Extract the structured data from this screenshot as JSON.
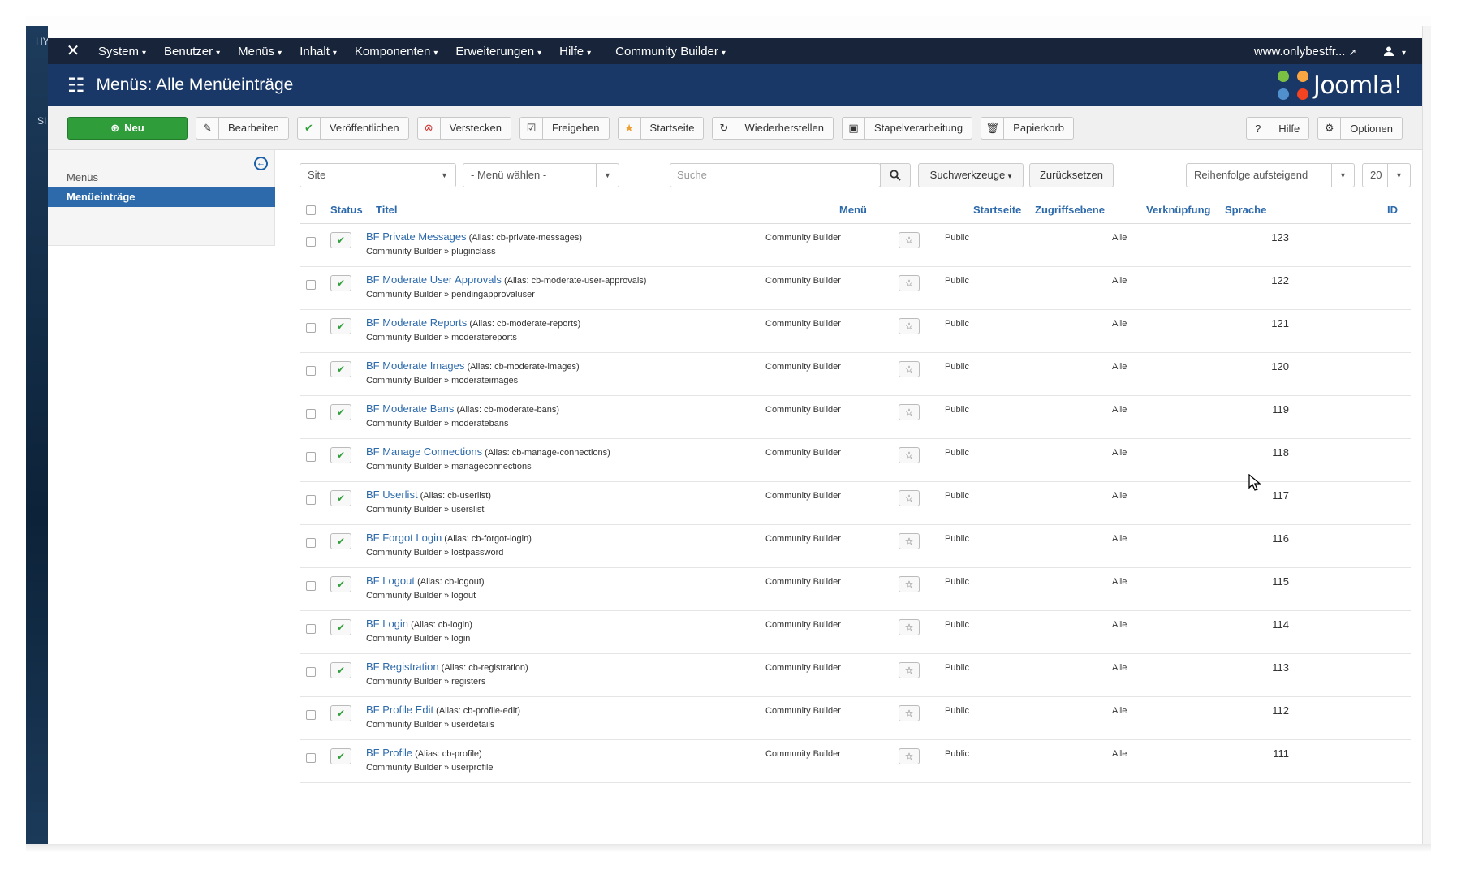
{
  "desktop": {
    "side_letters": [
      "HY",
      "SI"
    ]
  },
  "topnav": {
    "items": [
      {
        "label": "System"
      },
      {
        "label": "Benutzer"
      },
      {
        "label": "Menüs"
      },
      {
        "label": "Inhalt"
      },
      {
        "label": "Komponenten"
      },
      {
        "label": "Erweiterungen"
      },
      {
        "label": "Hilfe"
      },
      {
        "label": "Community Builder"
      }
    ],
    "site_link": "www.onlybestfr...",
    "caret": "▾",
    "user_icon": "user-icon",
    "external_icon": "↗"
  },
  "header": {
    "title": "Menüs: Alle Menüeinträge",
    "logo_text": "Joomla!",
    "logo_mark": "®"
  },
  "toolbar": {
    "new": "Neu",
    "edit": "Bearbeiten",
    "publish": "Veröffentlichen",
    "unpublish": "Verstecken",
    "checkin": "Freigeben",
    "home": "Startseite",
    "rebuild": "Wiederherstellen",
    "batch": "Stapelverarbeitung",
    "trash": "Papierkorb",
    "help": "Hilfe",
    "options": "Optionen"
  },
  "sidebar": {
    "items": [
      {
        "label": "Menüs"
      },
      {
        "label": "Menüeinträge"
      }
    ]
  },
  "filters": {
    "site": "Site",
    "menu": "- Menü wählen -",
    "search_placeholder": "Suche",
    "search_tools": "Suchwerkzeuge",
    "reset": "Zurücksetzen",
    "ordering": "Reihenfolge aufsteigend",
    "limit": "20"
  },
  "columns": {
    "status": "Status",
    "title": "Titel",
    "menu": "Menü",
    "home": "Startseite",
    "access": "Zugriffsebene",
    "association": "Verknüpfung",
    "language": "Sprache",
    "id": "ID"
  },
  "rows": [
    {
      "title": "BF Private Messages",
      "alias": "(Alias: cb-private-messages)",
      "path": "Community Builder » pluginclass",
      "menu": "Community Builder",
      "access": "Public",
      "language": "Alle",
      "id": "123"
    },
    {
      "title": "BF Moderate User Approvals",
      "alias": "(Alias: cb-moderate-user-approvals)",
      "path": "Community Builder » pendingapprovaluser",
      "menu": "Community Builder",
      "access": "Public",
      "language": "Alle",
      "id": "122"
    },
    {
      "title": "BF Moderate Reports",
      "alias": "(Alias: cb-moderate-reports)",
      "path": "Community Builder » moderatereports",
      "menu": "Community Builder",
      "access": "Public",
      "language": "Alle",
      "id": "121"
    },
    {
      "title": "BF Moderate Images",
      "alias": "(Alias: cb-moderate-images)",
      "path": "Community Builder » moderateimages",
      "menu": "Community Builder",
      "access": "Public",
      "language": "Alle",
      "id": "120"
    },
    {
      "title": "BF Moderate Bans",
      "alias": "(Alias: cb-moderate-bans)",
      "path": "Community Builder » moderatebans",
      "menu": "Community Builder",
      "access": "Public",
      "language": "Alle",
      "id": "119"
    },
    {
      "title": "BF Manage Connections",
      "alias": "(Alias: cb-manage-connections)",
      "path": "Community Builder » manageconnections",
      "menu": "Community Builder",
      "access": "Public",
      "language": "Alle",
      "id": "118"
    },
    {
      "title": "BF Userlist",
      "alias": "(Alias: cb-userlist)",
      "path": "Community Builder » userslist",
      "menu": "Community Builder",
      "access": "Public",
      "language": "Alle",
      "id": "117"
    },
    {
      "title": "BF Forgot Login",
      "alias": "(Alias: cb-forgot-login)",
      "path": "Community Builder » lostpassword",
      "menu": "Community Builder",
      "access": "Public",
      "language": "Alle",
      "id": "116"
    },
    {
      "title": "BF Logout",
      "alias": "(Alias: cb-logout)",
      "path": "Community Builder » logout",
      "menu": "Community Builder",
      "access": "Public",
      "language": "Alle",
      "id": "115"
    },
    {
      "title": "BF Login",
      "alias": "(Alias: cb-login)",
      "path": "Community Builder » login",
      "menu": "Community Builder",
      "access": "Public",
      "language": "Alle",
      "id": "114"
    },
    {
      "title": "BF Registration",
      "alias": "(Alias: cb-registration)",
      "path": "Community Builder » registers",
      "menu": "Community Builder",
      "access": "Public",
      "language": "Alle",
      "id": "113"
    },
    {
      "title": "BF Profile Edit",
      "alias": "(Alias: cb-profile-edit)",
      "path": "Community Builder » userdetails",
      "menu": "Community Builder",
      "access": "Public",
      "language": "Alle",
      "id": "112"
    },
    {
      "title": "BF Profile",
      "alias": "(Alias: cb-profile)",
      "path": "Community Builder » userprofile",
      "menu": "Community Builder",
      "access": "Public",
      "language": "Alle",
      "id": "111"
    }
  ],
  "colors": {
    "nav_bg": "#17243a",
    "header_bg": "#1a3867",
    "accent": "#2d6aab",
    "success": "#2f9e3a"
  }
}
